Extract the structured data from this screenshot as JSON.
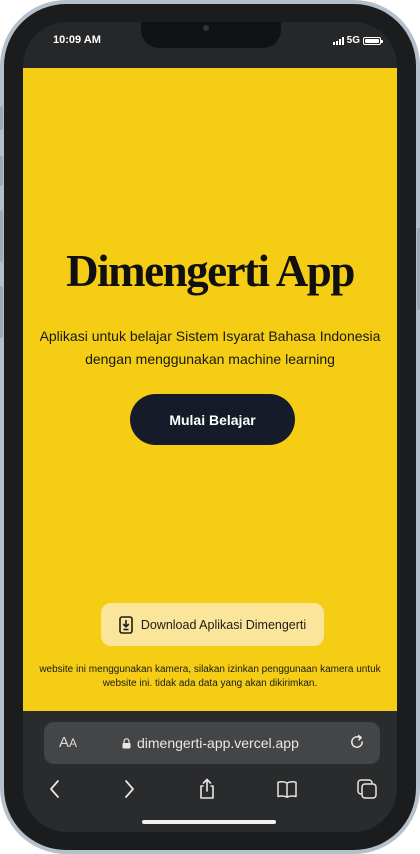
{
  "status_bar": {
    "time": "10:09 AM",
    "network": "5G",
    "signal_icon": "signal-bars-icon",
    "battery_icon": "battery-icon",
    "battery_level": 1.0
  },
  "page": {
    "background": "#f5cd15",
    "title": "Dimengerti App",
    "subtitle": "Aplikasi untuk belajar Sistem Isyarat Bahasa Indonesia dengan menggunakan machine learning",
    "cta_label": "Mulai Belajar",
    "cta_color": "#161b29",
    "download_label": "Download Aplikasi Dimengerti",
    "download_icon": "phone-download-icon",
    "download_color": "#fbe59a",
    "notice": "website ini menggunakan kamera, silakan izinkan penggunaan kamera untuk website ini. tidak ada data yang akan dikirimkan."
  },
  "browser": {
    "text_size_label_big": "A",
    "text_size_label_small": "A",
    "url": "dimengerti-app.vercel.app",
    "lock_icon": "lock-icon",
    "reload_icon": "reload-icon",
    "toolbar": {
      "back_icon": "chevron-left-icon",
      "forward_icon": "chevron-right-icon",
      "share_icon": "share-icon",
      "bookmarks_icon": "book-icon",
      "tabs_icon": "tabs-icon"
    }
  }
}
